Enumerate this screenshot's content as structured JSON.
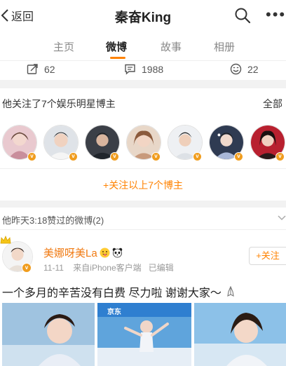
{
  "header": {
    "back_label": "返回",
    "title": "秦奋King"
  },
  "tabs": [
    {
      "label": "主页",
      "active": false
    },
    {
      "label": "微博",
      "active": true
    },
    {
      "label": "故事",
      "active": false
    },
    {
      "label": "相册",
      "active": false
    }
  ],
  "actions": {
    "repost_count": "62",
    "comment_count": "1988",
    "like_count": "22"
  },
  "follow_card": {
    "heading": "他关注了7个娱乐明星博主",
    "all_label": "全部",
    "avatars": [
      {
        "verified_badge": "v"
      },
      {
        "verified_badge": "v"
      },
      {
        "verified_badge": "v"
      },
      {
        "verified_badge": "v"
      },
      {
        "verified_badge": "v"
      },
      {
        "verified_badge": "v"
      },
      {
        "verified_badge": "v"
      }
    ],
    "follow_all_link": "+关注以上7个博主"
  },
  "liked_section": {
    "heading": "他昨天3:18赞过的微博(2)"
  },
  "post": {
    "author": "美娜呀美La",
    "verified_badge": "v",
    "date": "11-11",
    "source": "来自iPhone客户端",
    "edited": "已编辑",
    "follow_label": "+关注",
    "text": "一个多月的辛苦没有白费 尽力啦 谢谢大家～",
    "image_banner_text": "京东"
  },
  "colors": {
    "accent": "#ff8200",
    "verified": "#f09d1f",
    "author_name": "#f07a12"
  }
}
